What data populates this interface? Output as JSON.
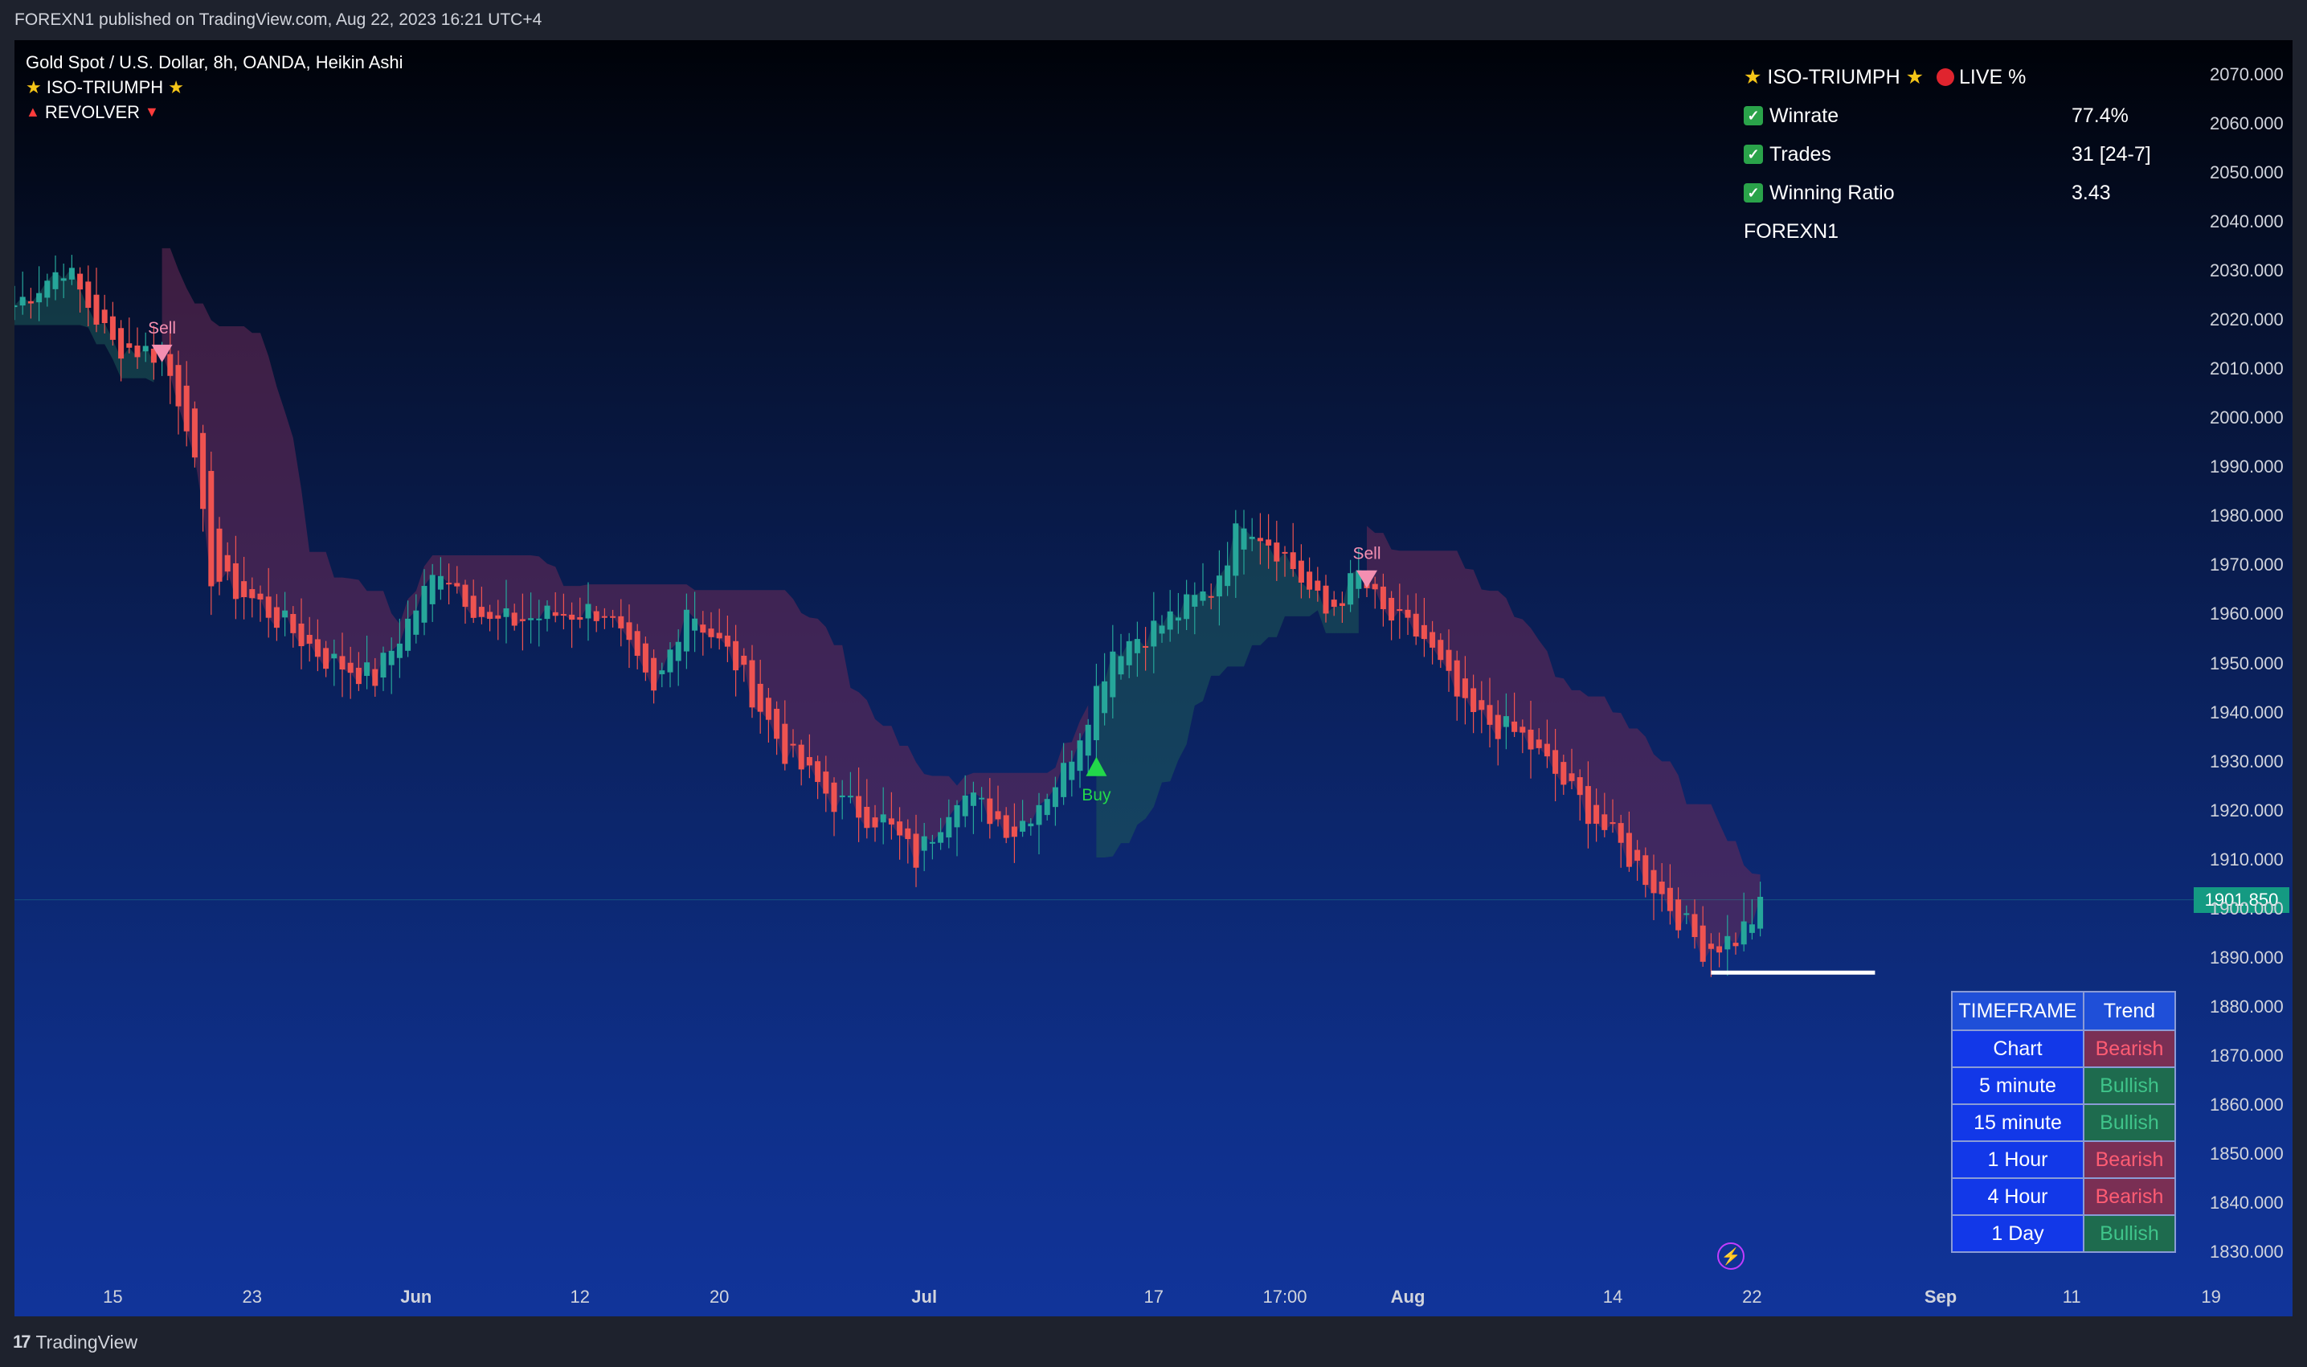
{
  "header": {
    "published": "FOREXN1 published on TradingView.com, Aug 22, 2023 16:21 UTC+4"
  },
  "legend": {
    "symbol": "Gold Spot / U.S. Dollar, 8h, OANDA, Heikin Ashi",
    "indicator1": "ISO-TRIUMPH",
    "indicator2": "REVOLVER"
  },
  "stats": {
    "title": "ISO-TRIUMPH",
    "live": "LIVE %",
    "rows": [
      {
        "label": "Winrate",
        "value": "77.4%"
      },
      {
        "label": "Trades",
        "value": "31 [24-7]"
      },
      {
        "label": "Winning Ratio",
        "value": "3.43"
      }
    ],
    "author": "FOREXN1"
  },
  "trend_table": {
    "headers": [
      "TIMEFRAME",
      "Trend"
    ],
    "rows": [
      {
        "tf": "Chart",
        "trend": "Bearish"
      },
      {
        "tf": "5 minute",
        "trend": "Bullish"
      },
      {
        "tf": "15 minute",
        "trend": "Bullish"
      },
      {
        "tf": "1 Hour",
        "trend": "Bearish"
      },
      {
        "tf": "4 Hour",
        "trend": "Bearish"
      },
      {
        "tf": "1 Day",
        "trend": "Bullish"
      }
    ]
  },
  "footer": {
    "brand": "TradingView"
  },
  "colors": {
    "bull": "#26a69a",
    "bear": "#ef5350",
    "cloud_bear": "#6b2a55",
    "cloud_bull": "#1d5a58",
    "buy_marker": "#22d84a",
    "sell_marker": "#f48fb1"
  },
  "chart_data": {
    "type": "candlestick",
    "style": "Heikin Ashi",
    "ylim": [
      1824,
      2077
    ],
    "yticks": [
      "2070.000",
      "2060.000",
      "2050.000",
      "2040.000",
      "2030.000",
      "2020.000",
      "2010.000",
      "2000.000",
      "1990.000",
      "1980.000",
      "1970.000",
      "1960.000",
      "1950.000",
      "1940.000",
      "1930.000",
      "1920.000",
      "1910.000",
      "1900.000",
      "1890.000",
      "1880.000",
      "1870.000",
      "1860.000",
      "1850.000",
      "1840.000",
      "1830.000"
    ],
    "last_price": "1901.850",
    "x_ticks": [
      {
        "label": "15",
        "i": 12,
        "bold": false
      },
      {
        "label": "23",
        "i": 29,
        "bold": false
      },
      {
        "label": "Jun",
        "i": 49,
        "bold": true
      },
      {
        "label": "12",
        "i": 69,
        "bold": false
      },
      {
        "label": "20",
        "i": 86,
        "bold": false
      },
      {
        "label": "Jul",
        "i": 111,
        "bold": true
      },
      {
        "label": "17",
        "i": 139,
        "bold": false
      },
      {
        "label": "17:00",
        "i": 155,
        "bold": false
      },
      {
        "label": "Aug",
        "i": 170,
        "bold": true
      },
      {
        "label": "14",
        "i": 195,
        "bold": false
      },
      {
        "label": "22",
        "i": 212,
        "bold": false
      },
      {
        "label": "Sep",
        "i": 235,
        "bold": true
      },
      {
        "label": "11",
        "i": 251,
        "bold": false
      },
      {
        "label": "19",
        "i": 268,
        "bold": false
      }
    ],
    "keypoints": [
      [
        0,
        2023
      ],
      [
        6,
        2031
      ],
      [
        12,
        2015
      ],
      [
        18,
        2013
      ],
      [
        21,
        2000
      ],
      [
        24,
        1968
      ],
      [
        30,
        1962
      ],
      [
        38,
        1951
      ],
      [
        44,
        1947
      ],
      [
        52,
        1970
      ],
      [
        58,
        1958
      ],
      [
        66,
        1960
      ],
      [
        72,
        1961
      ],
      [
        78,
        1943
      ],
      [
        82,
        1962
      ],
      [
        88,
        1950
      ],
      [
        94,
        1932
      ],
      [
        100,
        1922
      ],
      [
        106,
        1918
      ],
      [
        110,
        1910
      ],
      [
        115,
        1924
      ],
      [
        122,
        1916
      ],
      [
        128,
        1928
      ],
      [
        134,
        1953
      ],
      [
        140,
        1958
      ],
      [
        146,
        1965
      ],
      [
        150,
        1980
      ],
      [
        155,
        1972
      ],
      [
        160,
        1960
      ],
      [
        164,
        1968
      ],
      [
        167,
        1960
      ],
      [
        172,
        1955
      ],
      [
        177,
        1940
      ],
      [
        184,
        1935
      ],
      [
        192,
        1920
      ],
      [
        200,
        1905
      ],
      [
        206,
        1892
      ],
      [
        210,
        1894
      ],
      [
        213,
        1900
      ]
    ],
    "signals": [
      {
        "type": "Sell",
        "i": 18,
        "price": 2013
      },
      {
        "type": "Buy",
        "i": 132,
        "price": 1929
      },
      {
        "type": "Sell",
        "i": 165,
        "price": 1967
      }
    ],
    "support_line": {
      "price": 1887,
      "i_start": 207,
      "i_end": 227
    }
  }
}
